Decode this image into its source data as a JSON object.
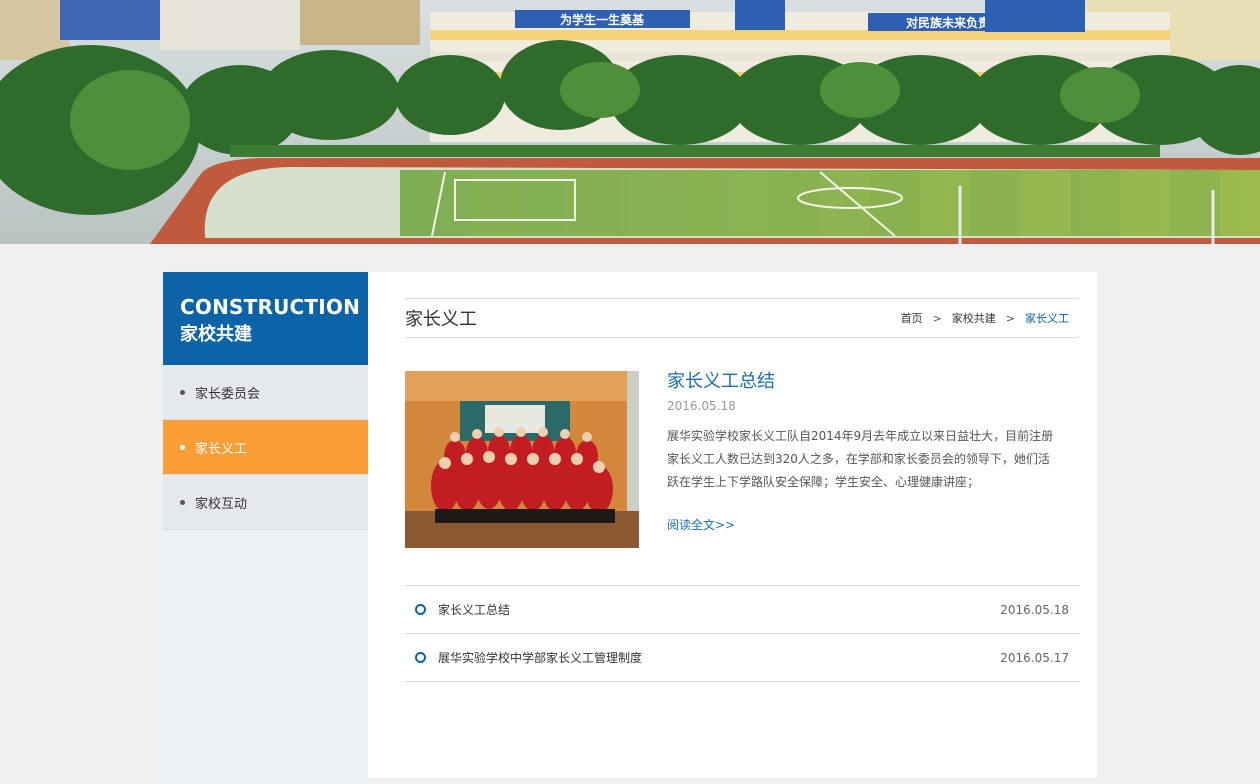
{
  "banner": {
    "sign_left": "为学生一生奠基",
    "sign_right": "对民族未来负责"
  },
  "sidebar": {
    "heading_en": "CONSTRUCTION",
    "heading_cn": "家校共建",
    "items": [
      {
        "label": "家长委员会",
        "active": false
      },
      {
        "label": "家长义工",
        "active": true
      },
      {
        "label": "家校互动",
        "active": false
      }
    ]
  },
  "page": {
    "title": "家长义工",
    "breadcrumb": {
      "home": "首页",
      "sep": ">",
      "section": "家校共建",
      "current": "家长义工"
    }
  },
  "feature": {
    "title": "家长义工总结",
    "date": "2016.05.18",
    "description": "展华实验学校家长义工队自2014年9月去年成立以来日益壮大，目前注册家长义工人数已达到320人之多，在学部和家长委员会的领导下，她们活跃在学生上下学路队安全保障；学生安全、心理健康讲座；",
    "read_more": "阅读全文>>"
  },
  "articles": [
    {
      "title": "家长义工总结",
      "date": "2016.05.18"
    },
    {
      "title": "展华实验学校中学部家长义工管理制度",
      "date": "2016.05.17"
    }
  ],
  "colors": {
    "brand_blue": "#0d63a7",
    "active_orange": "#fa9f37",
    "link_blue": "#1b6fb0"
  }
}
